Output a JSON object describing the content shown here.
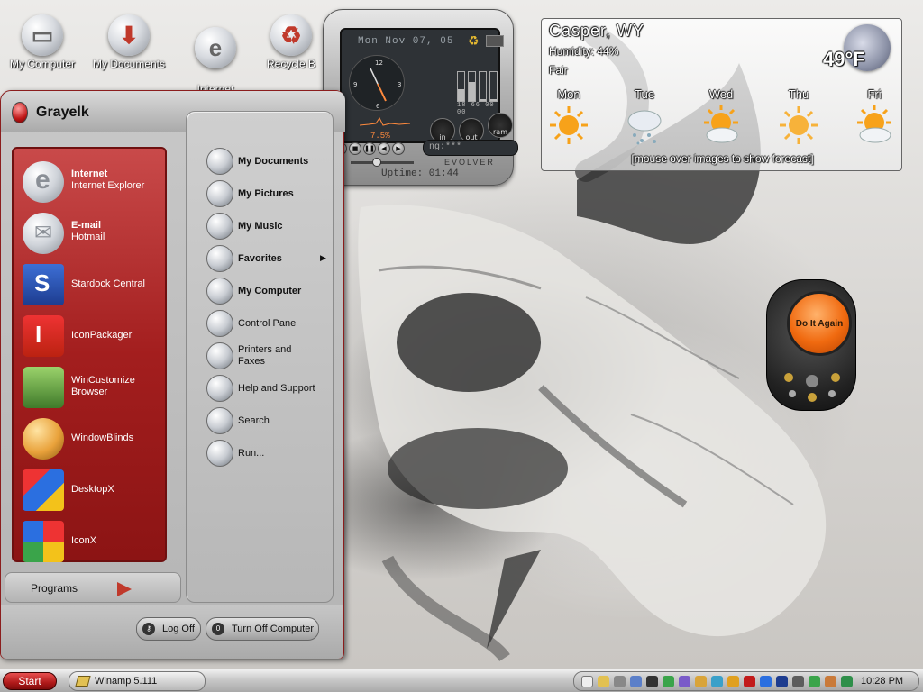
{
  "desktop": {
    "icons": [
      {
        "label": "My Computer",
        "icon": "computer-icon"
      },
      {
        "label": "My Documents",
        "icon": "documents-icon"
      },
      {
        "label": "Internet\nExplorer",
        "icon": "internet-explorer-icon"
      },
      {
        "label": "Recycle B",
        "icon": "recycle-bin-icon"
      }
    ]
  },
  "evolver": {
    "date": "Mon  Nov 07, 05",
    "cpu": "7.5%",
    "bars_label": "18 66 00 00",
    "gauges": [
      "in",
      "out",
      "ram"
    ],
    "track": "ng:***",
    "brand": "EVOLVER",
    "uptime": "Uptime: 01:44"
  },
  "weather": {
    "city": "Casper, WY",
    "humidity": "Humidity: 44%",
    "condition": "Fair",
    "temperature": "49°F",
    "days": [
      {
        "name": "Mon",
        "icon": "sunny-icon"
      },
      {
        "name": "Tue",
        "icon": "snow-icon"
      },
      {
        "name": "Wed",
        "icon": "partly-cloudy-icon"
      },
      {
        "name": "Thu",
        "icon": "sunny-icon"
      },
      {
        "name": "Fri",
        "icon": "partly-cloudy-icon"
      }
    ],
    "footer": "[mouse over images to show forecast]"
  },
  "orb": {
    "label": "Do It Again"
  },
  "startmenu": {
    "user": "Grayelk",
    "pinned": [
      {
        "title": "Internet",
        "subtitle": "Internet Explorer",
        "icon": "internet-explorer-icon"
      },
      {
        "title": "E-mail",
        "subtitle": "Hotmail",
        "icon": "email-icon"
      }
    ],
    "recent": [
      {
        "label": "Stardock Central",
        "icon": "stardock-central-icon"
      },
      {
        "label": "IconPackager",
        "icon": "iconpackager-icon"
      },
      {
        "label": "WinCustomize\nBrowser",
        "icon": "wincustomize-browser-icon"
      },
      {
        "label": "WindowBlinds",
        "icon": "windowblinds-icon"
      },
      {
        "label": "DesktopX",
        "icon": "desktopx-icon"
      },
      {
        "label": "IconX",
        "icon": "iconx-icon"
      }
    ],
    "places": [
      {
        "label": "My Documents",
        "bold": true,
        "icon": "documents-icon"
      },
      {
        "label": "My Pictures",
        "bold": true,
        "icon": "pictures-icon"
      },
      {
        "label": "My Music",
        "bold": true,
        "icon": "music-icon"
      },
      {
        "label": "Favorites",
        "bold": true,
        "icon": "favorites-icon",
        "submenu": true
      },
      {
        "label": "My Computer",
        "bold": true,
        "icon": "computer-icon"
      },
      {
        "label": "Control Panel",
        "bold": false,
        "icon": "control-panel-icon"
      },
      {
        "label": "Printers and\nFaxes",
        "bold": false,
        "icon": "printer-icon"
      },
      {
        "label": "Help and Support",
        "bold": false,
        "icon": "help-icon"
      },
      {
        "label": "Search",
        "bold": false,
        "icon": "search-icon"
      },
      {
        "label": "Run...",
        "bold": false,
        "icon": "run-icon"
      }
    ],
    "programs_label": "Programs",
    "logoff_label": "Log Off",
    "turnoff_label": "Turn Off Computer"
  },
  "taskbar": {
    "start_label": "Start",
    "task_label": "Winamp 5.111",
    "time": "10:28 PM"
  },
  "colors": {
    "accent_red": "#a31e1e",
    "chrome": "#b4b4b4"
  }
}
